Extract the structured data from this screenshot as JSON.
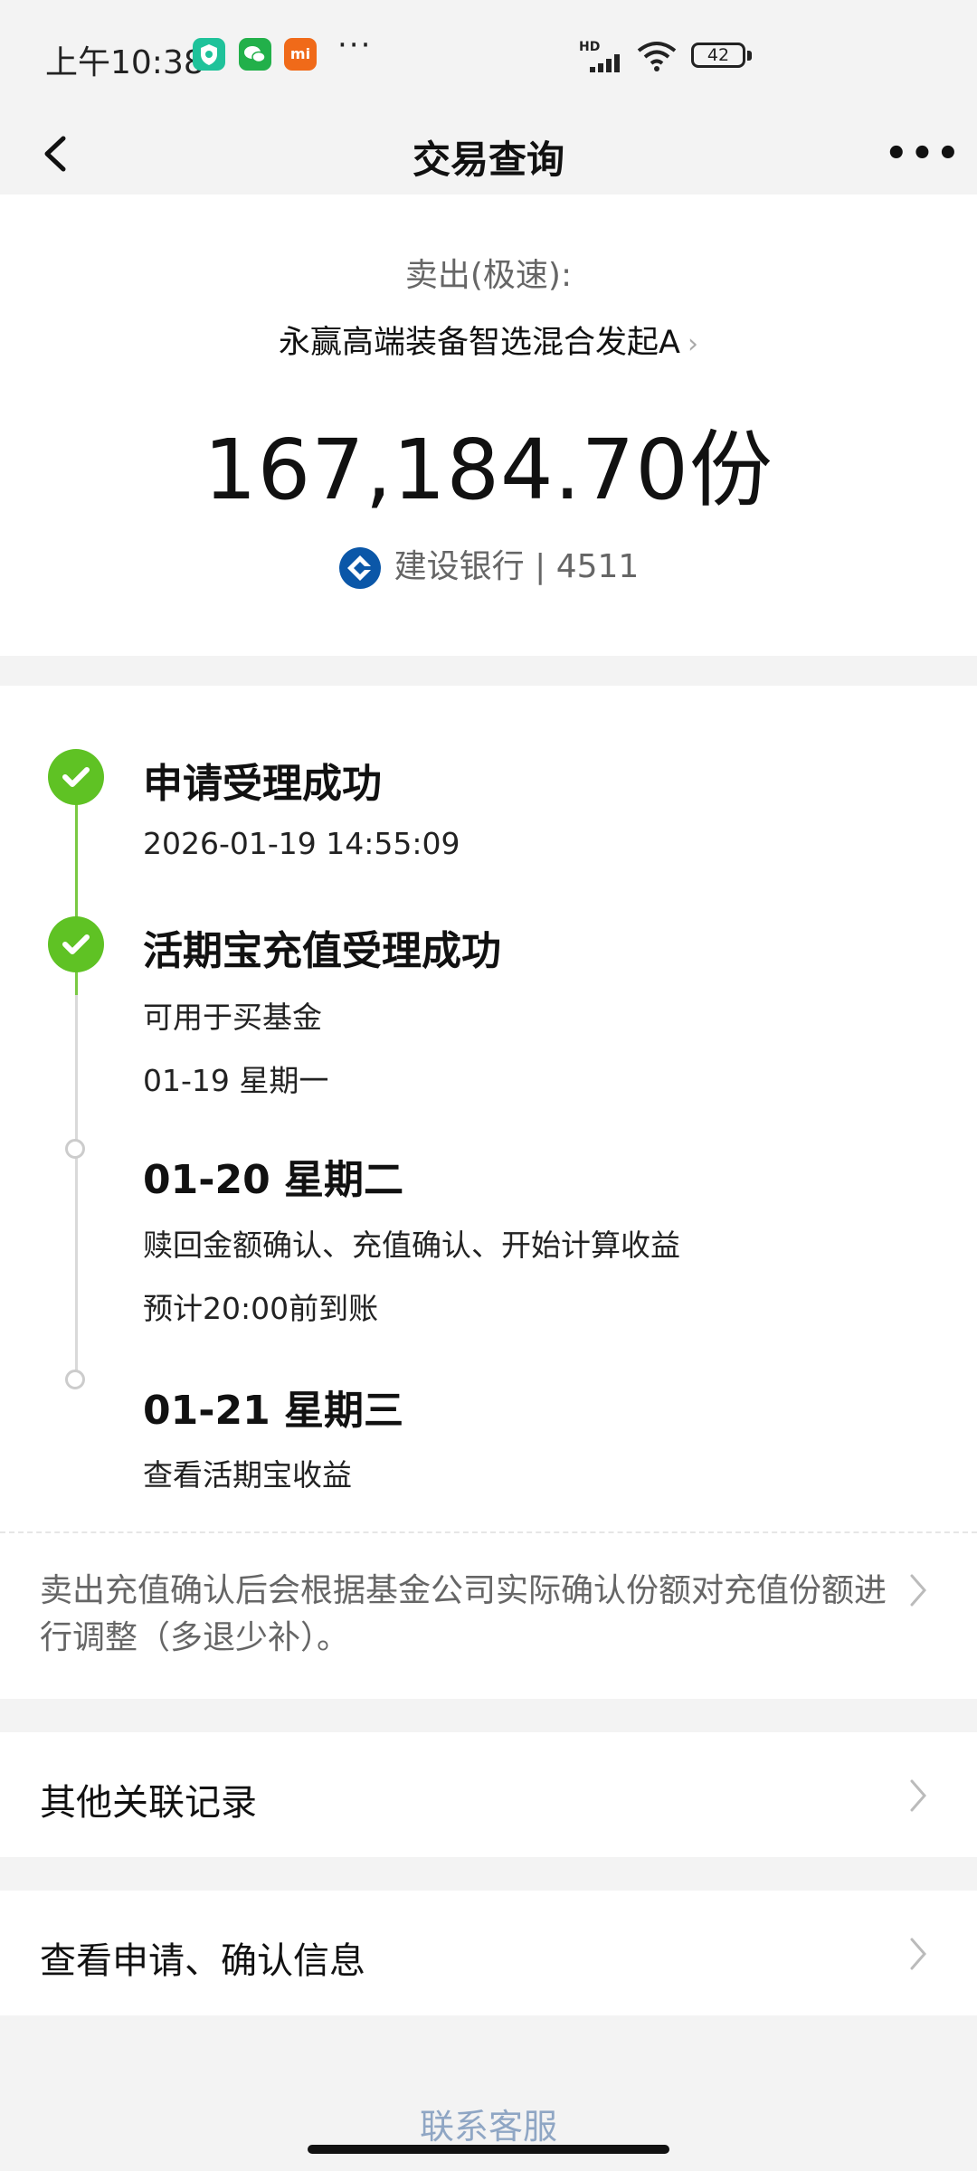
{
  "status_bar": {
    "time": "上午10:38",
    "app_icons": [
      "shield-app-icon",
      "wechat-icon",
      "mi-icon"
    ],
    "mi_label": "mi",
    "more": "···",
    "hd": "HD",
    "battery": "42"
  },
  "nav": {
    "title": "交易查询",
    "more": "•••"
  },
  "summary": {
    "type": "卖出(极速):",
    "fund_name": "永赢高端装备智选混合发起A",
    "chevron": "›",
    "shares": "167,184.70份",
    "bank": "建设银行 | 4511"
  },
  "timeline": {
    "steps": [
      {
        "title": "申请受理成功",
        "lines": [
          "2026-01-19 14:55:09"
        ],
        "status": "done"
      },
      {
        "title": "活期宝充值受理成功",
        "lines": [
          "可用于买基金",
          "01-19 星期一"
        ],
        "status": "done"
      },
      {
        "title": "01-20 星期二",
        "lines": [
          "赎回金额确认、充值确认、开始计算收益",
          "预计20:00前到账"
        ],
        "status": "pending"
      },
      {
        "title": "01-21 星期三",
        "lines": [
          "查看活期宝收益"
        ],
        "status": "pending"
      }
    ],
    "note": "卖出充值确认后会根据基金公司实际确认份额对充值份额进行调整（多退少补）。"
  },
  "links": {
    "related": "其他关联记录",
    "confirm_info": "查看申请、确认信息"
  },
  "footer": {
    "contact": "联系客服"
  },
  "colors": {
    "success": "#5fc224",
    "timeline_done": "#7ac943",
    "bank_blue": "#0b57a8",
    "background": "#f3f3f3"
  }
}
